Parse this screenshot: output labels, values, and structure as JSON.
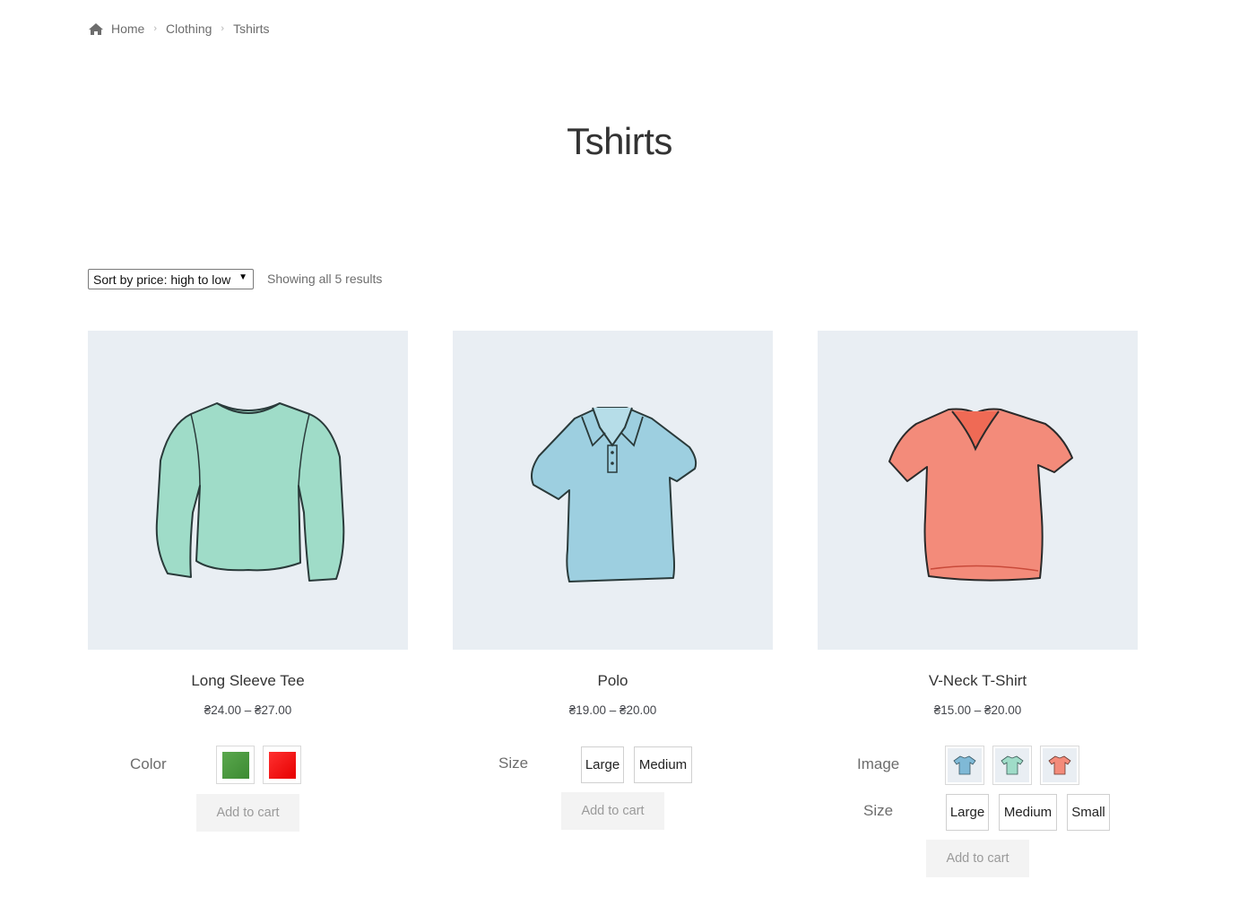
{
  "breadcrumb": {
    "home_icon": "home-icon",
    "items": [
      "Home",
      "Clothing",
      "Tshirts"
    ]
  },
  "page": {
    "title": "Tshirts"
  },
  "sorting": {
    "selected": "Sort by price: high to low",
    "results": "Showing all 5 results"
  },
  "colors": {
    "tile_bg": "#e9eef3",
    "green_swatch": "#4a9a3f",
    "red_swatch": "#ff1a1a",
    "mint": "#9fdcc8",
    "light_blue": "#9dcfe0",
    "coral": "#f38b7a"
  },
  "products": [
    {
      "name": "Long Sleeve Tee",
      "price": "₴24.00 – ₴27.00",
      "image_icon": "long-sleeve-tee-icon",
      "attributes": [
        {
          "label": "Color",
          "options": [
            "green",
            "red"
          ]
        }
      ],
      "cart_label": "Add to cart"
    },
    {
      "name": "Polo",
      "price": "₴19.00 – ₴20.00",
      "image_icon": "polo-shirt-icon",
      "attributes": [
        {
          "label": "Size",
          "options": [
            "Large",
            "Medium"
          ]
        }
      ],
      "cart_label": "Add to cart"
    },
    {
      "name": "V-Neck T-Shirt",
      "price": "₴15.00 – ₴20.00",
      "image_icon": "v-neck-tshirt-icon",
      "attributes": [
        {
          "label": "Image",
          "options": [
            "blue-tshirt",
            "mint-tshirt",
            "coral-tshirt"
          ]
        },
        {
          "label": "Size",
          "options": [
            "Large",
            "Medium",
            "Small"
          ]
        }
      ],
      "cart_label": "Add to cart"
    }
  ]
}
